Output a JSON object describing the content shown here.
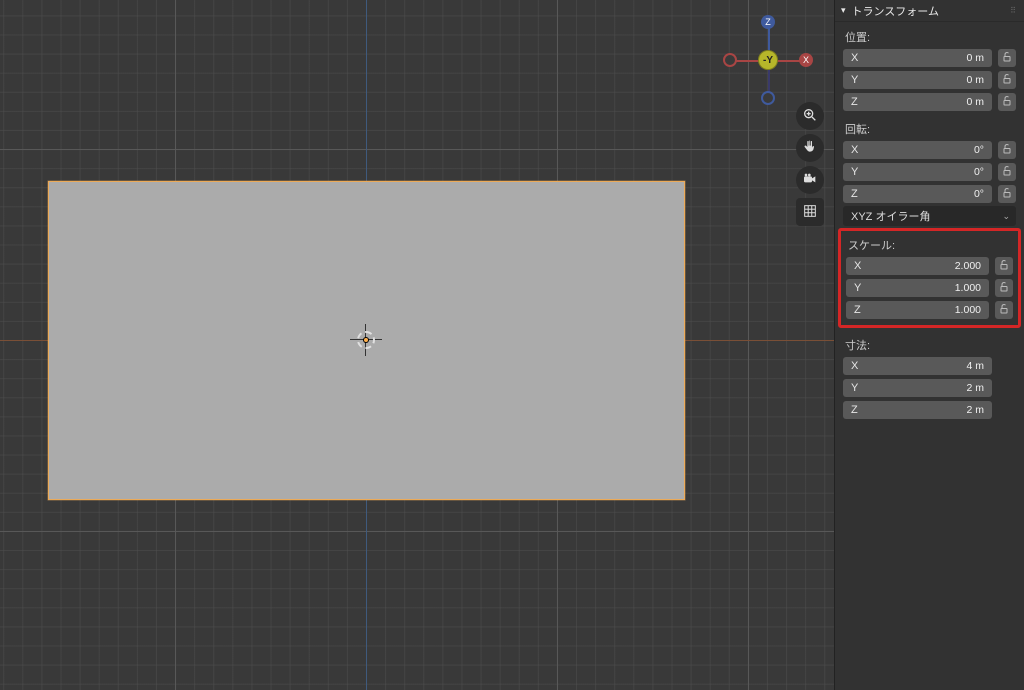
{
  "panel": {
    "title": "トランスフォーム"
  },
  "location": {
    "label": "位置:",
    "x_axis": "X",
    "x_value": "0 m",
    "y_axis": "Y",
    "y_value": "0 m",
    "z_axis": "Z",
    "z_value": "0 m"
  },
  "rotation": {
    "label": "回転:",
    "x_axis": "X",
    "x_value": "0°",
    "y_axis": "Y",
    "y_value": "0°",
    "z_axis": "Z",
    "z_value": "0°",
    "mode": "XYZ オイラー角"
  },
  "scale": {
    "label": "スケール:",
    "x_axis": "X",
    "x_value": "2.000",
    "y_axis": "Y",
    "y_value": "1.000",
    "z_axis": "Z",
    "z_value": "1.000"
  },
  "dimensions": {
    "label": "寸法:",
    "x_axis": "X",
    "x_value": "4 m",
    "y_axis": "Y",
    "y_value": "2 m",
    "z_axis": "Z",
    "z_value": "2 m"
  },
  "gizmo": {
    "negy": "-Y",
    "z": "Z",
    "x": "X"
  },
  "icons": {
    "zoom": "zoom-icon",
    "pan": "hand-icon",
    "camera": "camera-icon",
    "perspective": "grid-icon",
    "lock": "unlock-icon"
  }
}
